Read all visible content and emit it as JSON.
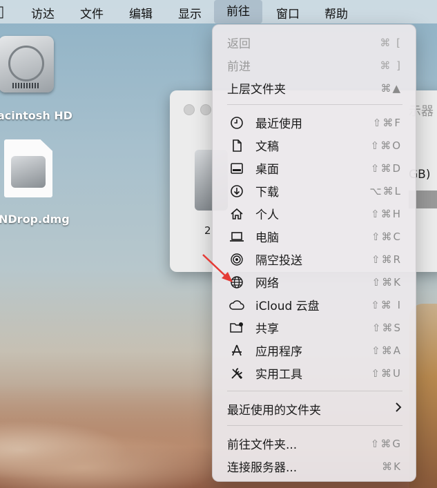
{
  "menubar": {
    "apple_icon": "apple-logo",
    "items": [
      "访达",
      "文件",
      "编辑",
      "显示",
      "前往",
      "窗口",
      "帮助"
    ],
    "active": "前往"
  },
  "desktop": {
    "icons": [
      {
        "label": "acintosh HD",
        "icon": "hard-drive-icon"
      },
      {
        "label": "NDrop.dmg",
        "icon": "dmg-file-icon"
      }
    ]
  },
  "finder_window": {
    "title_fragment": "示器",
    "size_fragment": "GB)",
    "item_fragment": "2"
  },
  "go_menu": {
    "top_items": [
      {
        "label": "返回",
        "shortcut": "⌘ [",
        "enabled": false
      },
      {
        "label": "前进",
        "shortcut": "⌘ ]",
        "enabled": false
      },
      {
        "label": "上层文件夹",
        "shortcut": "⌘▲",
        "enabled": true
      }
    ],
    "places": [
      {
        "label": "最近使用",
        "shortcut": "⇧⌘F",
        "icon": "clock-icon"
      },
      {
        "label": "文稿",
        "shortcut": "⇧⌘O",
        "icon": "document-icon"
      },
      {
        "label": "桌面",
        "shortcut": "⇧⌘D",
        "icon": "desktop-icon"
      },
      {
        "label": "下载",
        "shortcut": "⌥⌘L",
        "icon": "download-icon"
      },
      {
        "label": "个人",
        "shortcut": "⇧⌘H",
        "icon": "home-icon"
      },
      {
        "label": "电脑",
        "shortcut": "⇧⌘C",
        "icon": "laptop-icon"
      },
      {
        "label": "隔空投送",
        "shortcut": "⇧⌘R",
        "icon": "airdrop-icon"
      },
      {
        "label": "网络",
        "shortcut": "⇧⌘K",
        "icon": "globe-icon"
      },
      {
        "label": "iCloud 云盘",
        "shortcut": "⇧⌘ I",
        "icon": "cloud-icon"
      },
      {
        "label": "共享",
        "shortcut": "⇧⌘S",
        "icon": "shared-folder-icon"
      },
      {
        "label": "应用程序",
        "shortcut": "⇧⌘A",
        "icon": "applications-icon"
      },
      {
        "label": "实用工具",
        "shortcut": "⇧⌘U",
        "icon": "utilities-icon"
      }
    ],
    "recent_folders": {
      "label": "最近使用的文件夹"
    },
    "bottom_items": [
      {
        "label": "前往文件夹...",
        "shortcut": "⇧⌘G"
      },
      {
        "label": "连接服务器...",
        "shortcut": "⌘K"
      }
    ]
  },
  "colors": {
    "arrow": "#e53b36"
  }
}
